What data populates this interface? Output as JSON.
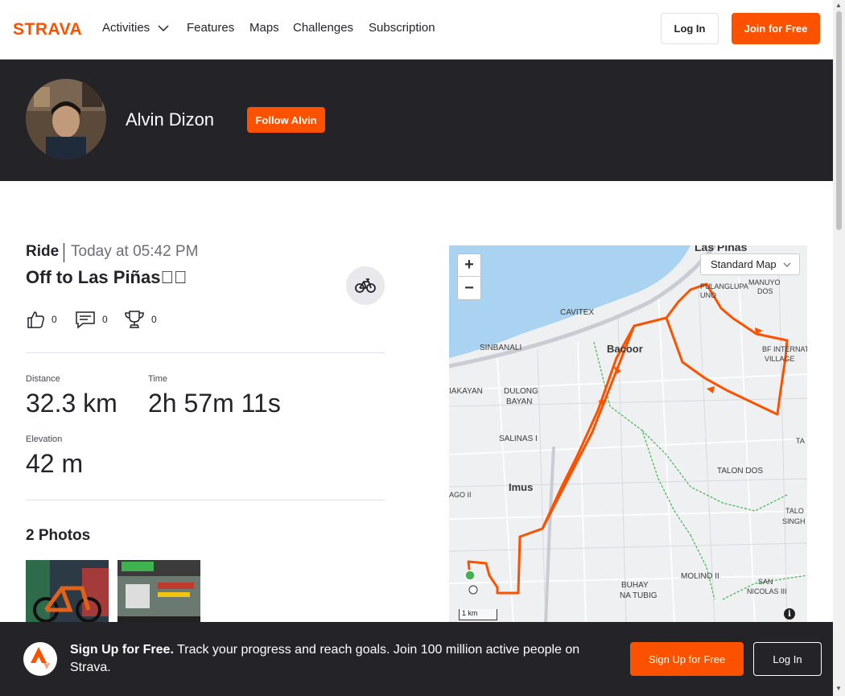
{
  "nav": {
    "logo": "STRAVA",
    "items": [
      "Activities",
      "Features",
      "Maps",
      "Challenges",
      "Subscription"
    ],
    "login": "Log In",
    "join": "Join for Free"
  },
  "athlete": {
    "name": "Alvin Dizon",
    "follow": "Follow Alvin"
  },
  "activity": {
    "type": "Ride",
    "time": "Today at 05:42 PM",
    "title": "Off to Las Piñas\u0000\u0000",
    "kudos": "0",
    "comments": "0",
    "achievements": "0"
  },
  "stats": {
    "distance_label": "Distance",
    "distance_value": "32.3 km",
    "time_label": "Time",
    "time_value": "2h 57m 11s",
    "elevation_label": "Elevation",
    "elevation_value": "42 m"
  },
  "photos": {
    "title": "2 Photos"
  },
  "map": {
    "zoom_in": "+",
    "zoom_out": "−",
    "map_type": "Standard Map",
    "scale": "1 km",
    "info": "i",
    "labels": {
      "las_pinas": "Las Piñas",
      "pulanglupa": "PULANGLUPA",
      "uno": "UNO",
      "manuyo": "MANUYO",
      "dos": "DOS",
      "cavitex": "CAVITEX",
      "sinbanali": "SINBANALI",
      "bacoor": "Bacoor",
      "bf": "BF INTERNATIO",
      "village": "VILLAGE",
      "iakayan": "IAKAYAN",
      "dulong": "DULONG",
      "bayan": "BAYAN",
      "ta": "TA",
      "salinas": "SALINAS I",
      "imus": "Imus",
      "ago": "AGO II",
      "talon": "TALON DOS",
      "talo": "TALO",
      "singh": "SINGH",
      "buhay": "BUHAY",
      "natubig": "NA TUBIG",
      "molino": "MOLINO II",
      "san": "SAN",
      "nicolas": "NICOLAS III"
    },
    "route_color": "#fc5200"
  },
  "banner": {
    "bold": "Sign Up for Free.",
    "text": " Track your progress and reach goals. Join 100 million active people on Strava.",
    "signup": "Sign Up for Free",
    "login": "Log In"
  }
}
